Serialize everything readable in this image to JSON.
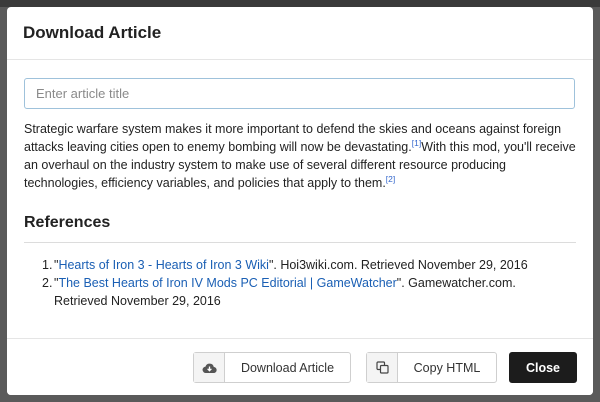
{
  "modal": {
    "title": "Download Article"
  },
  "form": {
    "title_placeholder": "Enter article title",
    "title_value": ""
  },
  "article": {
    "part1": "Strategic warfare system makes it more important to defend the skies and oceans against foreign attacks leaving cities open to enemy bombing will now be devastating.",
    "cite1": "[1]",
    "part2": "With this mod, you'll receive an overhaul on the industry system to make use of several different resource producing technologies, efficiency variables, and policies that apply to them.",
    "cite2": "[2]"
  },
  "references": {
    "heading": "References",
    "items": [
      {
        "num": "1.",
        "open_quote": "\"",
        "link": "Hearts of Iron 3 - Hearts of Iron 3 Wiki",
        "rest": "\". Hoi3wiki.com. Retrieved November 29, 2016"
      },
      {
        "num": "2.",
        "open_quote": "\"",
        "link": "The Best Hearts of Iron IV Mods PC Editorial | GameWatcher",
        "rest": "\". Gamewatcher.com. Retrieved November 29, 2016"
      }
    ]
  },
  "footer": {
    "download_label": "Download Article",
    "download_icon": "cloud-download-icon",
    "copy_label": "Copy HTML",
    "copy_icon": "copy-icon",
    "close_label": "Close"
  },
  "colors": {
    "link": "#1a5fb4",
    "close_button": "#1c1c1c",
    "input_border": "#9fc2db"
  }
}
